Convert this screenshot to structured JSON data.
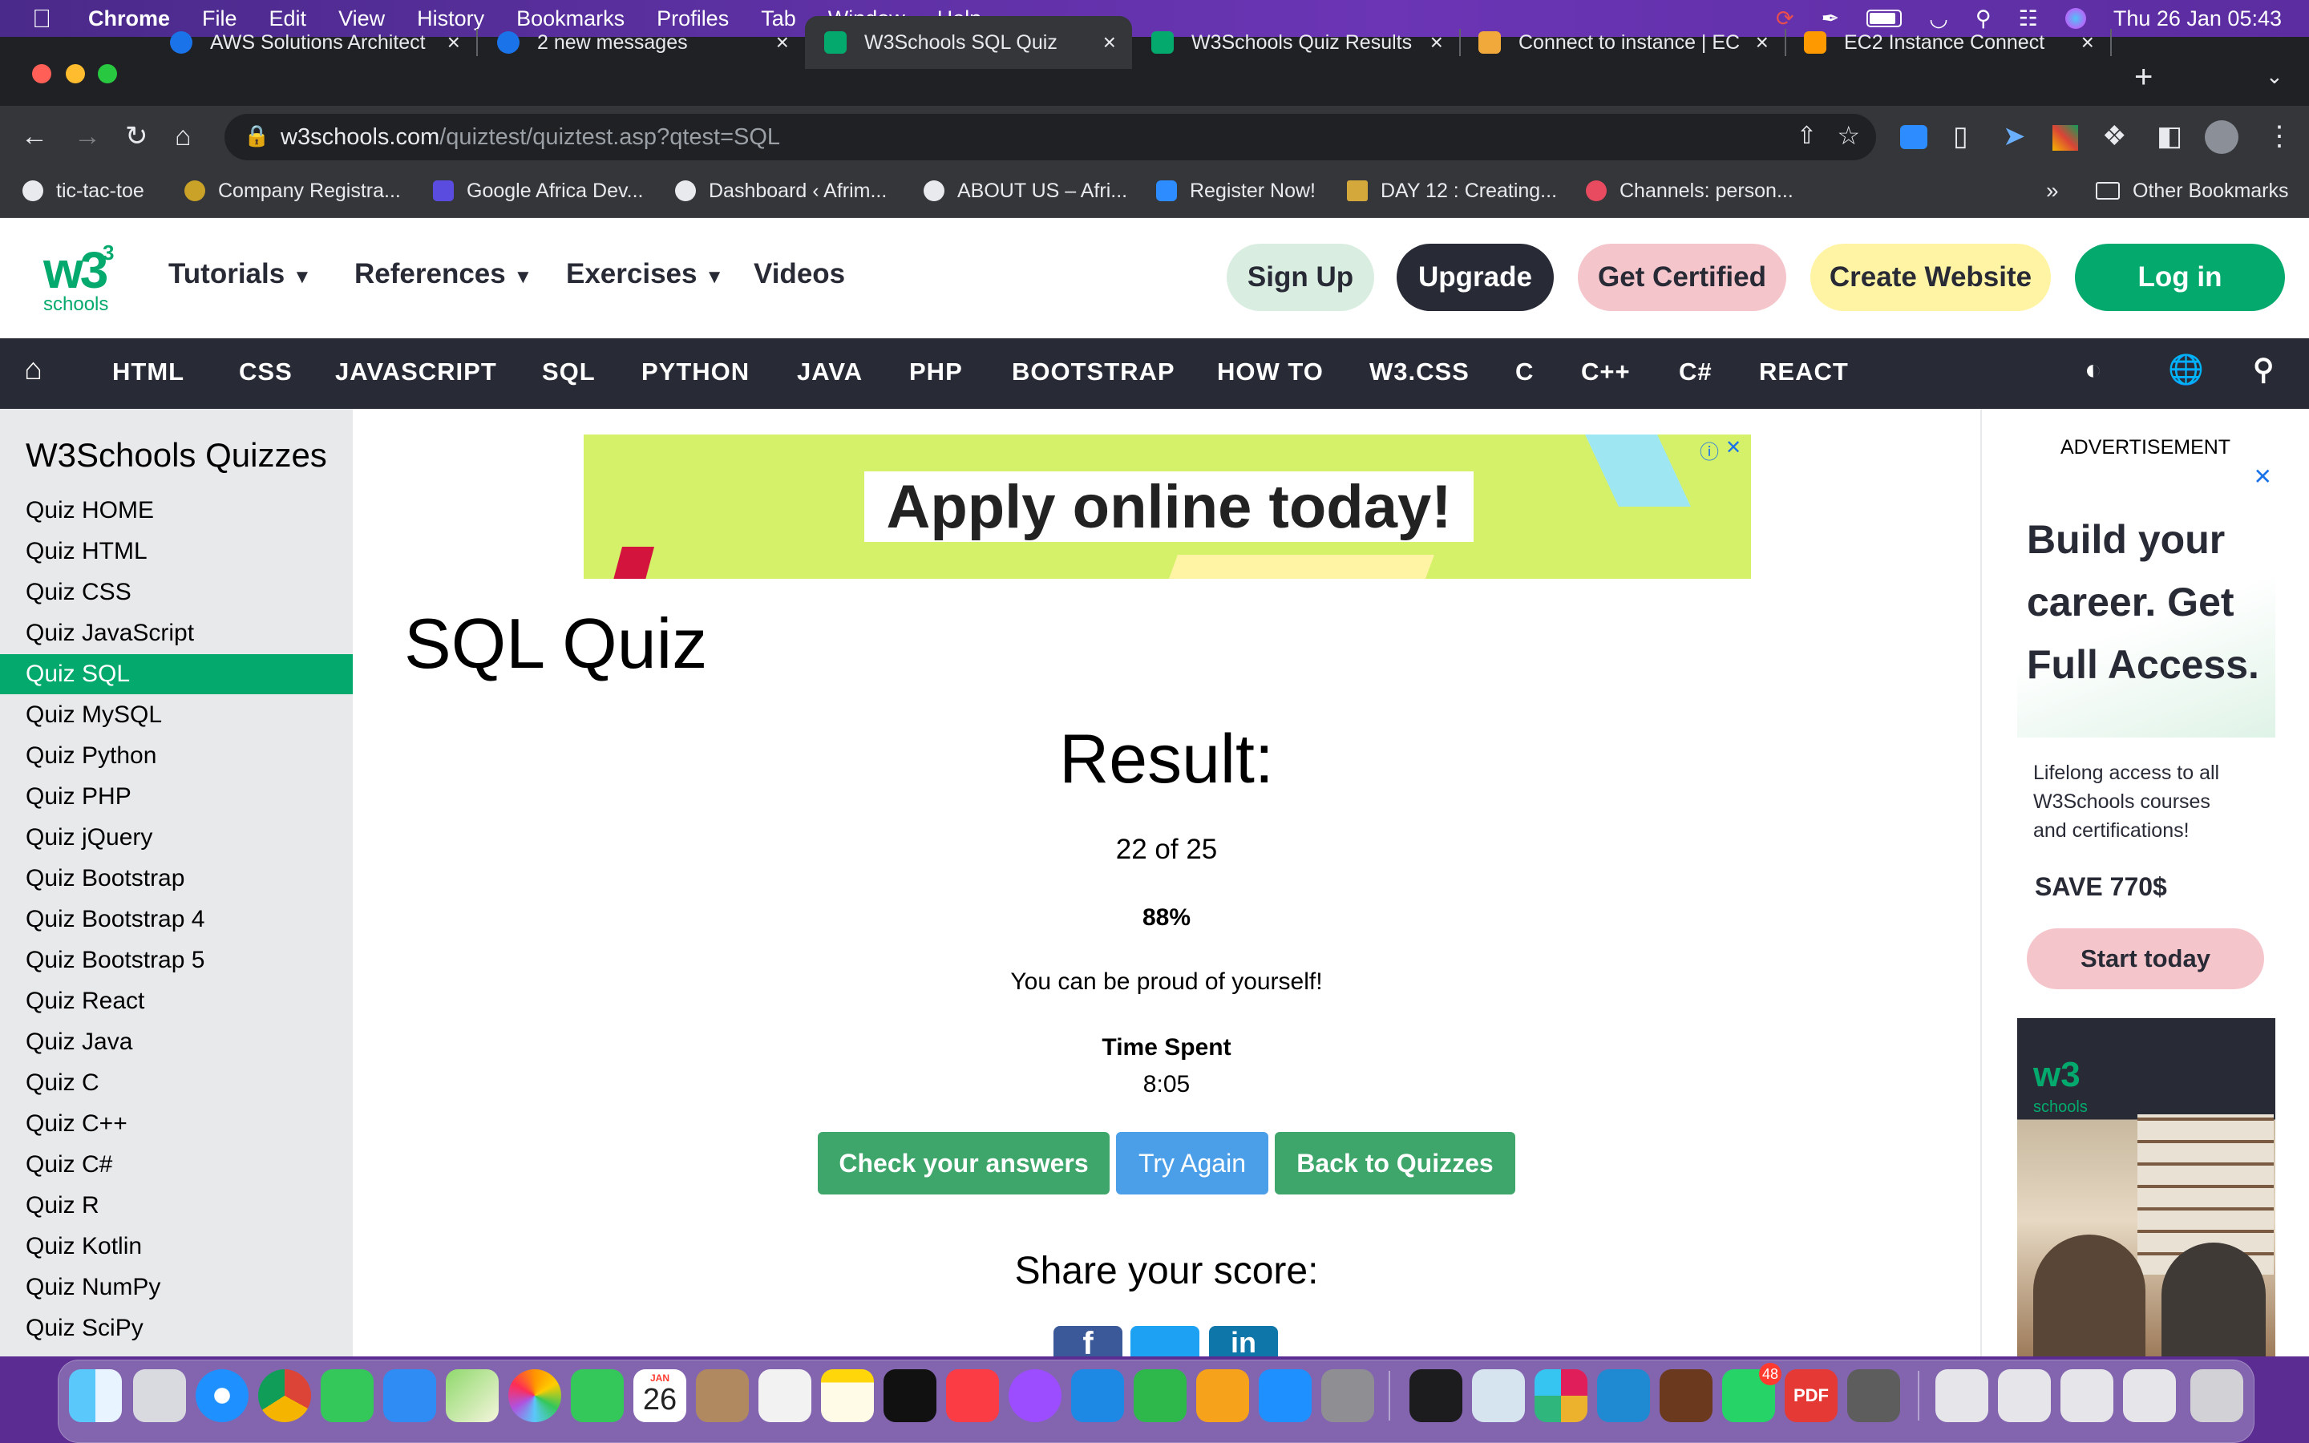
{
  "menubar": {
    "app": "Chrome",
    "items": [
      "File",
      "Edit",
      "View",
      "History",
      "Bookmarks",
      "Profiles",
      "Tab",
      "Window",
      "Help"
    ],
    "datetime": "Thu 26 Jan  05:43"
  },
  "tabs": [
    {
      "title": "AWS Solutions Architect",
      "color": "#1a73e8"
    },
    {
      "title": "2 new messages",
      "color": "#1a73e8"
    },
    {
      "title": "W3Schools SQL Quiz",
      "color": "#04aa6d",
      "active": true
    },
    {
      "title": "W3Schools Quiz Results",
      "color": "#04aa6d"
    },
    {
      "title": "Connect to instance | EC",
      "color": "#f2a93b"
    },
    {
      "title": "EC2 Instance Connect",
      "color": "#ff9900"
    }
  ],
  "address": {
    "domain": "w3schools.com",
    "path": "/quiztest/quiztest.asp?qtest=SQL"
  },
  "bookmarks": [
    "tic-tac-toe",
    "Company Registra...",
    "Google Africa Dev...",
    "Dashboard ‹ Afrim...",
    "ABOUT US – Afri...",
    "Register Now!",
    "DAY 12 : Creating...",
    "Channels: person..."
  ],
  "other_bookmarks": "Other Bookmarks",
  "w3": {
    "logo_main": "w3",
    "logo_sup": "3",
    "logo_sub": "schools",
    "nav": [
      "Tutorials",
      "References",
      "Exercises",
      "Videos"
    ],
    "signup": "Sign Up",
    "upgrade": "Upgrade",
    "certified": "Get Certified",
    "create": "Create Website",
    "login": "Log in"
  },
  "topnav": [
    "HTML",
    "CSS",
    "JAVASCRIPT",
    "SQL",
    "PYTHON",
    "JAVA",
    "PHP",
    "BOOTSTRAP",
    "HOW TO",
    "W3.CSS",
    "C",
    "C++",
    "C#",
    "REACT"
  ],
  "sidebar": {
    "title": "W3Schools Quizzes",
    "items": [
      "Quiz HOME",
      "Quiz HTML",
      "Quiz CSS",
      "Quiz JavaScript",
      "Quiz SQL",
      "Quiz MySQL",
      "Quiz Python",
      "Quiz PHP",
      "Quiz jQuery",
      "Quiz Bootstrap",
      "Quiz Bootstrap 4",
      "Quiz Bootstrap 5",
      "Quiz React",
      "Quiz Java",
      "Quiz C",
      "Quiz C++",
      "Quiz C#",
      "Quiz R",
      "Quiz Kotlin",
      "Quiz NumPy",
      "Quiz SciPy"
    ],
    "active": "Quiz SQL"
  },
  "banner": {
    "text": "Apply online today!"
  },
  "main": {
    "title": "SQL Quiz",
    "result_label": "Result:",
    "score": "22 of 25",
    "percent": "88%",
    "message": "You can be proud of yourself!",
    "time_label": "Time Spent",
    "time": "8:05",
    "check": "Check your answers",
    "try": "Try Again",
    "back": "Back to Quizzes",
    "share": "Share your score:"
  },
  "ad": {
    "label": "ADVERTISEMENT",
    "headline1": "Build your",
    "headline2": "career. Get",
    "headline3": "Full Access.",
    "sub1": "Lifelong access to all",
    "sub2": "W3Schools courses",
    "sub3": "and certifications!",
    "save": "SAVE 770$",
    "cta": "Start today",
    "brand": "w3",
    "brand_sub": "schools"
  },
  "dock": {
    "calendar_month": "JAN",
    "calendar_day": "26",
    "whatsapp_badge": "48"
  }
}
